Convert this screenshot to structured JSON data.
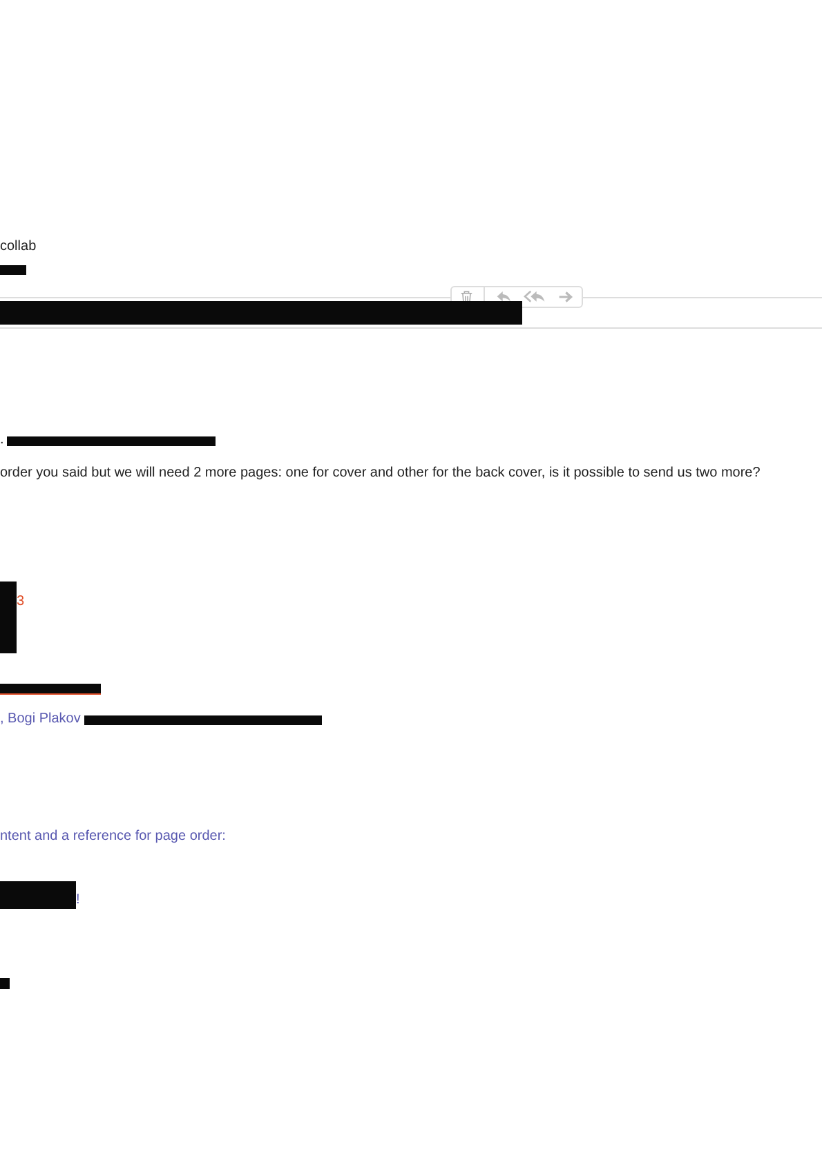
{
  "header": {
    "subject": "collab",
    "toolbar": [
      {
        "kind": "delete"
      },
      {
        "kind": "reply"
      },
      {
        "kind": "reply_all"
      },
      {
        "kind": "forward"
      }
    ]
  },
  "body": {
    "greeting_end": ".",
    "message": "order you said but we will need 2 more pages: one for cover and other for the back cover, is it possible to send us two more?",
    "signature_fragment": "3",
    "recipients": ", Bogi Plakov",
    "quote": "ntent and a reference for page order:",
    "closing": "!"
  }
}
